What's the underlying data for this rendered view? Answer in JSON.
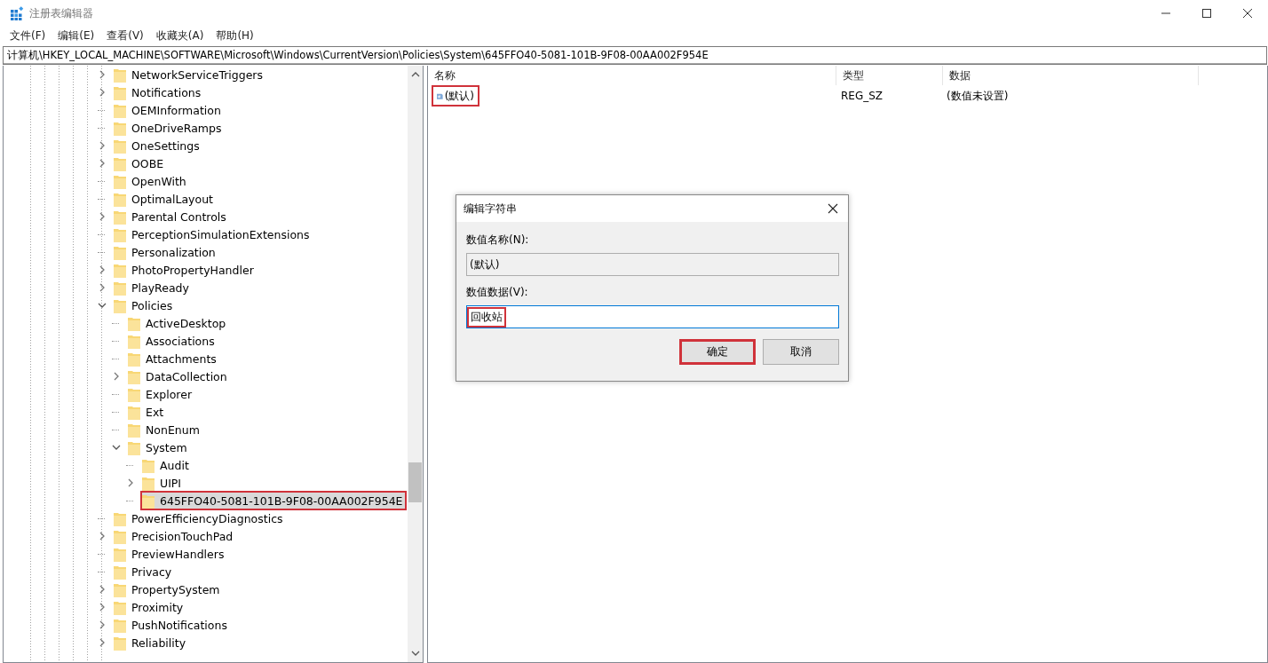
{
  "window": {
    "title": "注册表编辑器"
  },
  "menu": [
    "文件(F)",
    "编辑(E)",
    "查看(V)",
    "收藏夹(A)",
    "帮助(H)"
  ],
  "address": "计算机\\HKEY_LOCAL_MACHINE\\SOFTWARE\\Microsoft\\Windows\\CurrentVersion\\Policies\\System\\645FFO40-5081-101B-9F08-00AA002F954E",
  "tree": [
    {
      "label": "NetworkServiceTriggers",
      "kind": "collapsed",
      "selected": false,
      "highlighted": false
    },
    {
      "label": "Notifications",
      "kind": "collapsed",
      "selected": false,
      "highlighted": false
    },
    {
      "label": "OEMInformation",
      "kind": "leaf",
      "selected": false,
      "highlighted": false
    },
    {
      "label": "OneDriveRamps",
      "kind": "leaf",
      "selected": false,
      "highlighted": false
    },
    {
      "label": "OneSettings",
      "kind": "collapsed",
      "selected": false,
      "highlighted": false
    },
    {
      "label": "OOBE",
      "kind": "collapsed",
      "selected": false,
      "highlighted": false
    },
    {
      "label": "OpenWith",
      "kind": "leaf",
      "selected": false,
      "highlighted": false
    },
    {
      "label": "OptimalLayout",
      "kind": "leaf",
      "selected": false,
      "highlighted": false
    },
    {
      "label": "Parental Controls",
      "kind": "collapsed",
      "selected": false,
      "highlighted": false
    },
    {
      "label": "PerceptionSimulationExtensions",
      "kind": "leaf",
      "selected": false,
      "highlighted": false
    },
    {
      "label": "Personalization",
      "kind": "leaf",
      "selected": false,
      "highlighted": false
    },
    {
      "label": "PhotoPropertyHandler",
      "kind": "collapsed",
      "selected": false,
      "highlighted": false
    },
    {
      "label": "PlayReady",
      "kind": "collapsed",
      "selected": false,
      "highlighted": false
    },
    {
      "label": "Policies",
      "kind": "expanded",
      "selected": false,
      "highlighted": false,
      "children": [
        {
          "label": "ActiveDesktop",
          "kind": "leaf",
          "selected": false,
          "highlighted": false
        },
        {
          "label": "Associations",
          "kind": "leaf",
          "selected": false,
          "highlighted": false
        },
        {
          "label": "Attachments",
          "kind": "leaf",
          "selected": false,
          "highlighted": false
        },
        {
          "label": "DataCollection",
          "kind": "collapsed",
          "selected": false,
          "highlighted": false
        },
        {
          "label": "Explorer",
          "kind": "leaf",
          "selected": false,
          "highlighted": false
        },
        {
          "label": "Ext",
          "kind": "leaf",
          "selected": false,
          "highlighted": false
        },
        {
          "label": "NonEnum",
          "kind": "leaf",
          "selected": false,
          "highlighted": false
        },
        {
          "label": "System",
          "kind": "expanded",
          "selected": false,
          "highlighted": false,
          "children": [
            {
              "label": "Audit",
              "kind": "leaf",
              "selected": false,
              "highlighted": false
            },
            {
              "label": "UIPI",
              "kind": "collapsed",
              "selected": false,
              "highlighted": false
            },
            {
              "label": "645FFO40-5081-101B-9F08-00AA002F954E",
              "kind": "leaf",
              "selected": true,
              "highlighted": true
            }
          ]
        }
      ]
    },
    {
      "label": "PowerEfficiencyDiagnostics",
      "kind": "leaf",
      "selected": false,
      "highlighted": false
    },
    {
      "label": "PrecisionTouchPad",
      "kind": "collapsed",
      "selected": false,
      "highlighted": false
    },
    {
      "label": "PreviewHandlers",
      "kind": "leaf",
      "selected": false,
      "highlighted": false
    },
    {
      "label": "Privacy",
      "kind": "leaf",
      "selected": false,
      "highlighted": false
    },
    {
      "label": "PropertySystem",
      "kind": "collapsed",
      "selected": false,
      "highlighted": false
    },
    {
      "label": "Proximity",
      "kind": "collapsed",
      "selected": false,
      "highlighted": false
    },
    {
      "label": "PushNotifications",
      "kind": "collapsed",
      "selected": false,
      "highlighted": false
    },
    {
      "label": "Reliability",
      "kind": "collapsed",
      "selected": false,
      "highlighted": false
    }
  ],
  "values": {
    "columns": [
      "名称",
      "类型",
      "数据"
    ],
    "rows": [
      {
        "name": "(默认)",
        "type": "REG_SZ",
        "data": "(数值未设置)",
        "highlighted": true
      }
    ]
  },
  "dialog": {
    "title": "编辑字符串",
    "name_label": "数值名称(N):",
    "name_value": "(默认)",
    "data_label": "数值数据(V):",
    "data_value": "回收站",
    "data_highlighted": true,
    "buttons": [
      {
        "label": "确定",
        "highlighted": true
      },
      {
        "label": "取消",
        "highlighted": false
      }
    ]
  }
}
